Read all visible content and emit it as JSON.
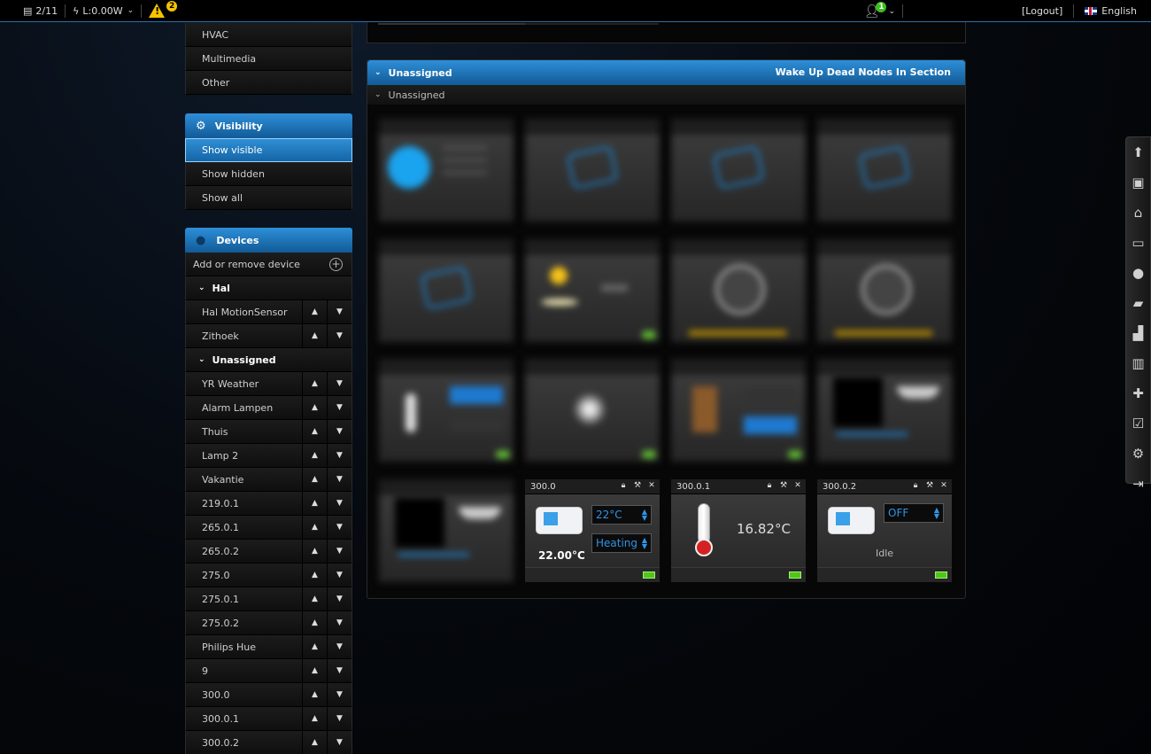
{
  "topbar": {
    "updates": "2/11",
    "power": "L:0.00W",
    "warning_count": "2",
    "user_badge": "1",
    "logout": "[Logout]",
    "language": "English"
  },
  "sidebar": {
    "top_items": [
      "HVAC",
      "Multimedia",
      "Other"
    ],
    "visibility": {
      "title": "Visibility",
      "items": [
        "Show visible",
        "Show hidden",
        "Show all"
      ]
    },
    "devices": {
      "title": "Devices",
      "add_label": "Add or remove device",
      "groups": [
        {
          "name": "Hal",
          "items": [
            "Hal MotionSensor",
            "Zithoek"
          ]
        },
        {
          "name": "Unassigned",
          "items": [
            "YR Weather",
            "Alarm Lampen",
            "Thuis",
            "Lamp 2",
            "Vakantie",
            "219.0.1",
            "265.0.1",
            "265.0.2",
            "275.0",
            "275.0.1",
            "275.0.2",
            "Philips Hue",
            "9",
            "300.0",
            "300.0.1",
            "300.0.2"
          ]
        }
      ]
    }
  },
  "section": {
    "title": "Unassigned",
    "wake_link": "Wake Up Dead Nodes In Section",
    "subheading": "Unassigned"
  },
  "tiles": {
    "t300": {
      "name": "300.0",
      "setpoint": "22°C",
      "mode": "Heating",
      "current": "22.00°C"
    },
    "t3001": {
      "name": "300.0.1",
      "temperature": "16.82°C"
    },
    "t3002": {
      "name": "300.0.2",
      "mode": "OFF",
      "status": "Idle"
    }
  },
  "colors": {
    "accent": "#1f7bc0",
    "battery": "#52c41a"
  }
}
